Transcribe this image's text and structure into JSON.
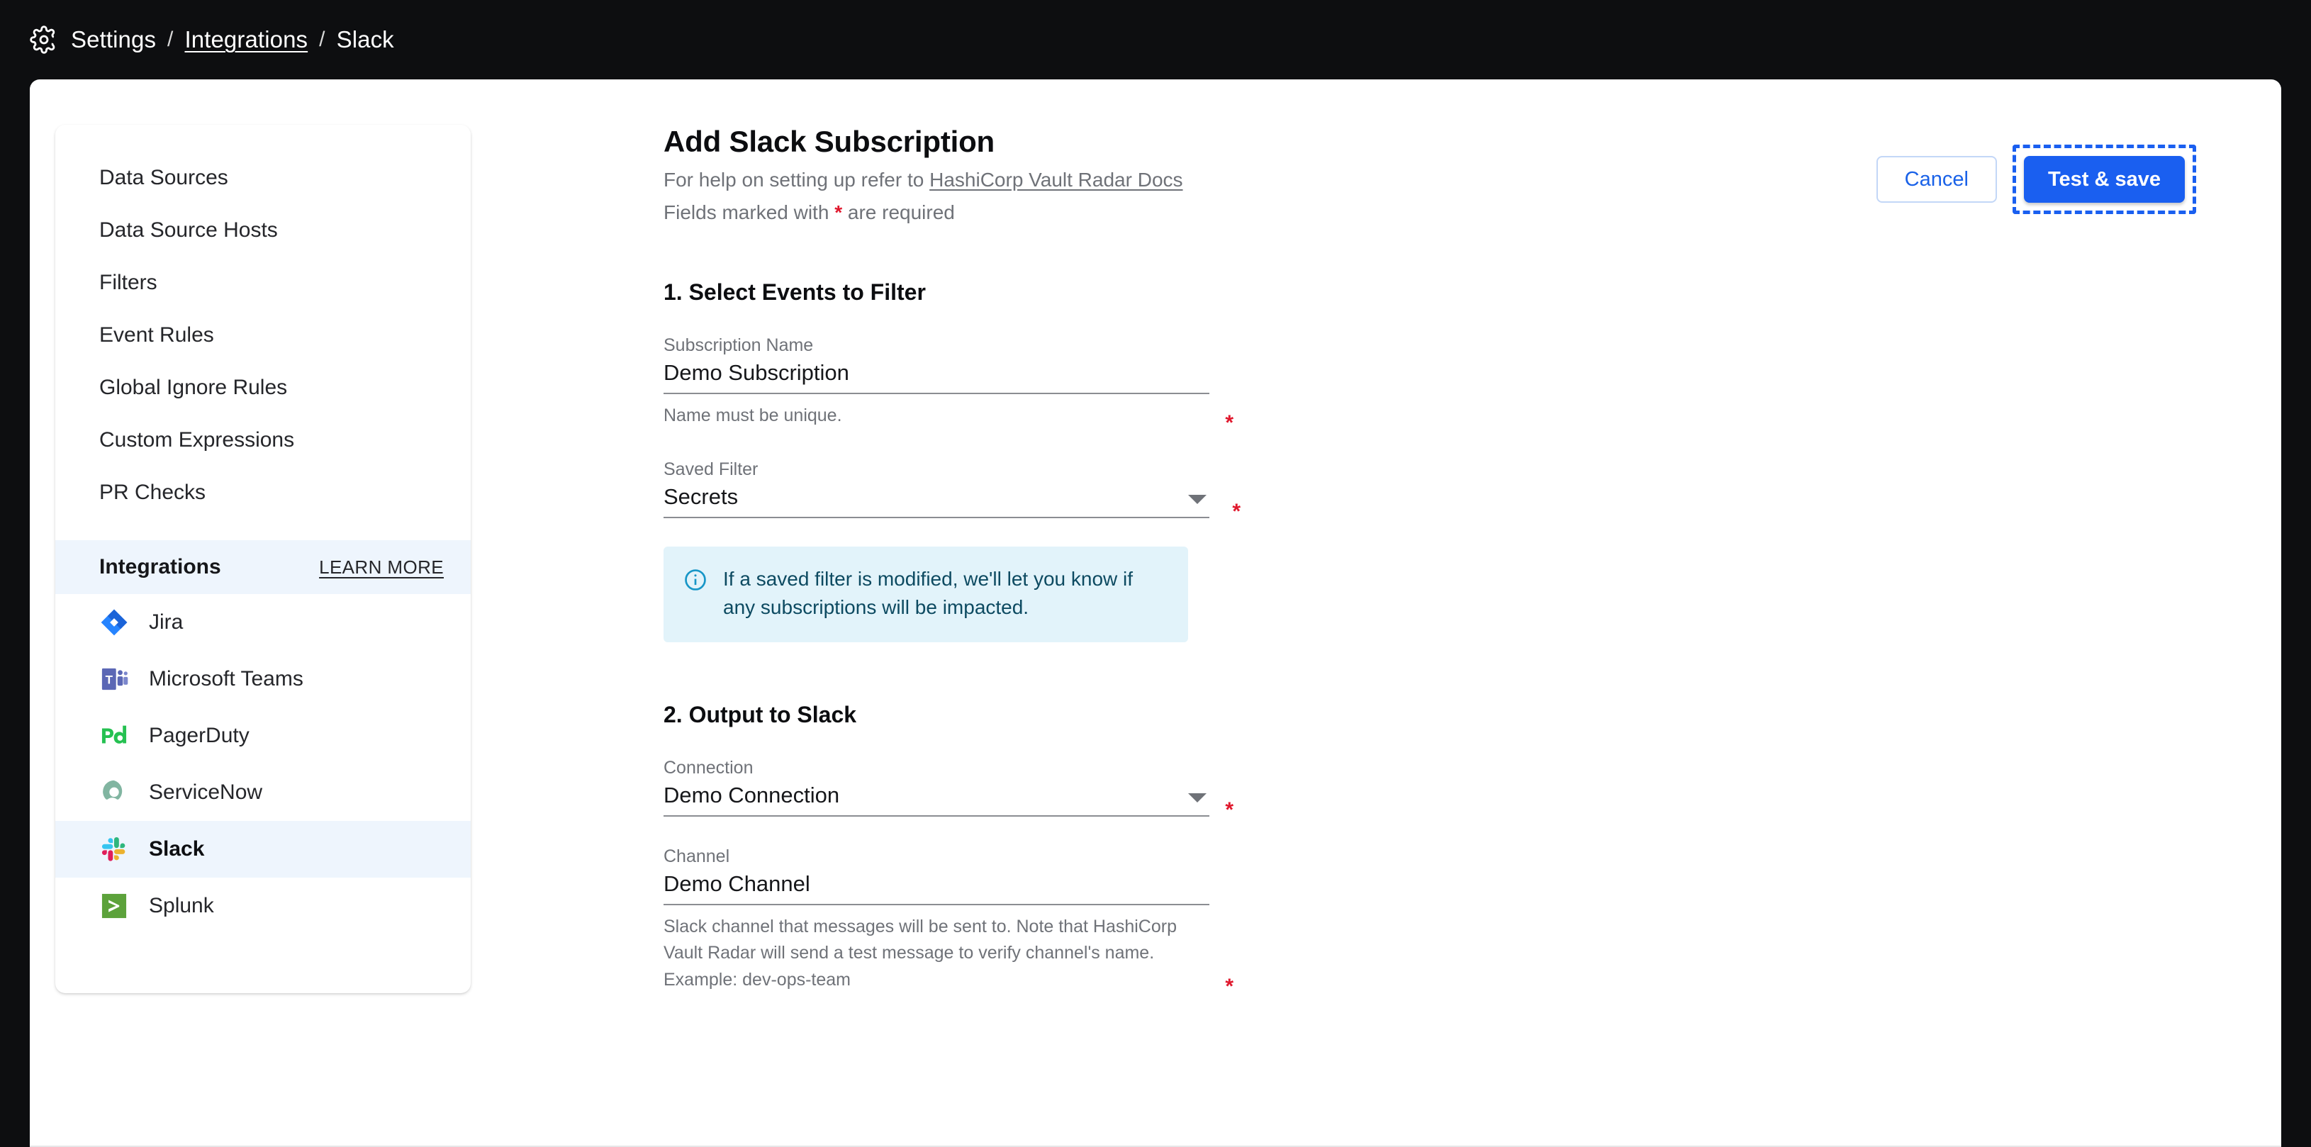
{
  "breadcrumb": {
    "gear_icon": "gear-icon",
    "items": [
      {
        "label": "Settings",
        "link": false
      },
      {
        "label": "Integrations",
        "link": true
      },
      {
        "label": "Slack",
        "link": false
      }
    ],
    "separator": "/"
  },
  "sidebar": {
    "nav": [
      {
        "label": "Data Sources"
      },
      {
        "label": "Data Source Hosts"
      },
      {
        "label": "Filters"
      },
      {
        "label": "Event Rules"
      },
      {
        "label": "Global Ignore Rules"
      },
      {
        "label": "Custom Expressions"
      },
      {
        "label": "PR Checks"
      }
    ],
    "integrations_header": {
      "title": "Integrations",
      "learn_more": "LEARN MORE"
    },
    "integrations": [
      {
        "label": "Jira",
        "icon": "jira-icon",
        "active": false
      },
      {
        "label": "Microsoft Teams",
        "icon": "microsoft-teams-icon",
        "active": false
      },
      {
        "label": "PagerDuty",
        "icon": "pagerduty-icon",
        "active": false
      },
      {
        "label": "ServiceNow",
        "icon": "servicenow-icon",
        "active": false
      },
      {
        "label": "Slack",
        "icon": "slack-icon",
        "active": true
      },
      {
        "label": "Splunk",
        "icon": "splunk-icon",
        "active": false
      }
    ]
  },
  "main": {
    "title": "Add Slack Subscription",
    "help_prefix": "For help on setting up refer to ",
    "help_link": "HashiCorp Vault Radar Docs",
    "required_prefix": "Fields marked with ",
    "required_star": "*",
    "required_suffix": " are required",
    "section1": {
      "heading": "1. Select Events to Filter",
      "subscription_name": {
        "label": "Subscription Name",
        "value": "Demo Subscription",
        "helper": "Name must be unique.",
        "required_marker": "*"
      },
      "saved_filter": {
        "label": "Saved Filter",
        "value": "Secrets",
        "required_marker": "*"
      },
      "callout": {
        "icon": "info-circle-icon",
        "text": "If a saved filter is modified, we'll let you know if any subscriptions will be impacted."
      }
    },
    "section2": {
      "heading": "2. Output to Slack",
      "connection": {
        "label": "Connection",
        "value": "Demo Connection",
        "required_marker": "*"
      },
      "channel": {
        "label": "Channel",
        "value": "Demo Channel",
        "helper": "Slack channel that messages will be sent to. Note that HashiCorp Vault Radar will send a test message to verify channel's name. Example: dev-ops-team",
        "required_marker": "*"
      }
    }
  },
  "actions": {
    "cancel": "Cancel",
    "save": "Test & save"
  },
  "colors": {
    "header_background": "#0d0e10",
    "accent_blue": "#1a5ff0",
    "required_red": "#e0182d",
    "active_item_background": "#eef5fd",
    "callout_background": "#e2f3fa",
    "callout_text": "#0d4a61"
  }
}
